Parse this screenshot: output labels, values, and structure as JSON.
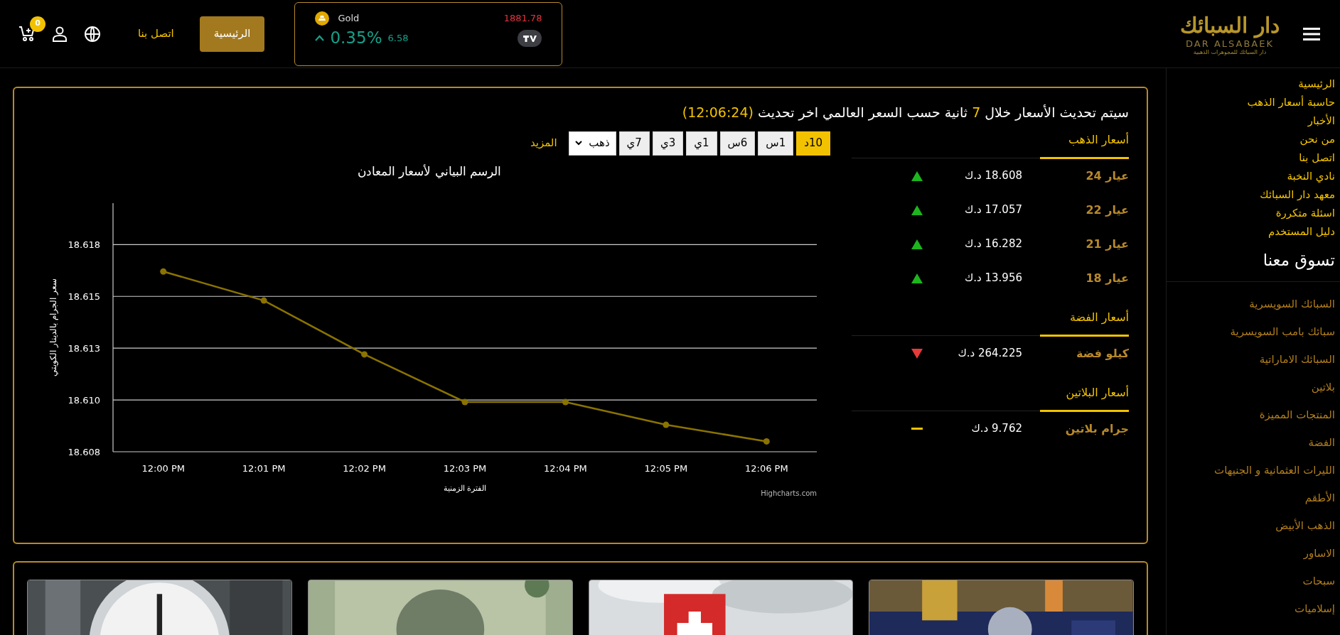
{
  "header": {
    "logo": {
      "title": "دار السبائك",
      "latin": "DAR ALSABAEK",
      "tagline": "دار السبائك للمجوهرات الذهبية"
    },
    "ticker": {
      "symbol": "Gold",
      "price": "1881.78",
      "change_percent": "0.35%",
      "change": "6.58",
      "positive": true
    },
    "nav_buttons": [
      {
        "label": "الرئيسية",
        "selected": true
      },
      {
        "label": "اتصل بنا",
        "selected": false
      }
    ],
    "cart": {
      "count": "0"
    }
  },
  "prices_panel": {
    "notice": {
      "before": "سيتم تحديث الأسعار خلال",
      "seconds": "7",
      "after": "ثانية حسب السعر العالمي اخر تحديث",
      "time": "(12:06:24)"
    },
    "sections": [
      {
        "title": "أسعار الذهب",
        "rows": [
          {
            "label": "عيار 24",
            "price": "18.608 د.ك",
            "kind": "up"
          },
          {
            "label": "عيار 22",
            "price": "17.057 د.ك",
            "kind": "up"
          },
          {
            "label": "عيار 21",
            "price": "16.282 د.ك",
            "kind": "up"
          },
          {
            "label": "عيار 18",
            "price": "13.956 د.ك",
            "kind": "up"
          }
        ]
      },
      {
        "title": "أسعار الفضة",
        "rows": [
          {
            "label": "كيلو فضة",
            "price": "264.225 د.ك",
            "kind": "down"
          }
        ]
      },
      {
        "title": "أسعار البلاتين",
        "rows": [
          {
            "label": "جرام بلاتين",
            "price": "9.762 د.ك",
            "kind": "flat"
          }
        ]
      }
    ],
    "range_buttons": [
      {
        "label": "10د",
        "selected": true
      },
      {
        "label": "1س",
        "selected": false
      },
      {
        "label": "6س",
        "selected": false
      },
      {
        "label": "1ي",
        "selected": false
      },
      {
        "label": "3ي",
        "selected": false
      },
      {
        "label": "7ي",
        "selected": false
      }
    ],
    "metal_select": {
      "value": "ذهب"
    },
    "more_link": "المزيد",
    "chart": {
      "credit": "Highcharts.com",
      "chart_data": {
        "type": "line",
        "title": "الرسم البياني لأسعار المعادن",
        "xlabel": "الفترة الزمنية",
        "ylabel": "سعر الجرام بالدينار الكويتي",
        "categories": [
          "12:00 PM",
          "12:01 PM",
          "12:02 PM",
          "12:03 PM",
          "12:04 PM",
          "12:05 PM",
          "12:06 PM"
        ],
        "grid": true,
        "series": [
          {
            "color": "#8a7300",
            "marker": true,
            "values": [
              18.6167,
              18.6153,
              18.6127,
              18.6104,
              18.6104,
              18.6093,
              18.6085
            ]
          }
        ],
        "ylim": [
          18.608,
          18.62
        ],
        "yticks": [
          {
            "value": 18.608,
            "label": "18.608"
          },
          {
            "value": 18.6105,
            "label": "18.610"
          },
          {
            "value": 18.613,
            "label": "18.613"
          },
          {
            "value": 18.6155,
            "label": "18.615"
          },
          {
            "value": 18.618,
            "label": "18.618"
          }
        ]
      }
    }
  },
  "sidebar": {
    "nav_links": [
      "الرئيسية",
      "حاسبة أسعار الذهب",
      "الأخبار",
      "من نحن",
      "اتصل بنا",
      "نادي النخبة",
      "معهد دار السبائك",
      "اسئلة متكررة",
      "دليل المستخدم"
    ],
    "shop_heading": "تسوق معنا",
    "shop_links": [
      "السبائك السويسرية",
      "سبائك بامب السويسرية",
      "السبائك الاماراتية",
      "بلاتين",
      "المنتجات المميزة",
      "الفضة",
      "الليرات العثمانية و الجنيهات",
      "الأطقم",
      "الذهب الأبيض",
      "الاساور",
      "سبحات",
      "إسلاميات"
    ]
  }
}
